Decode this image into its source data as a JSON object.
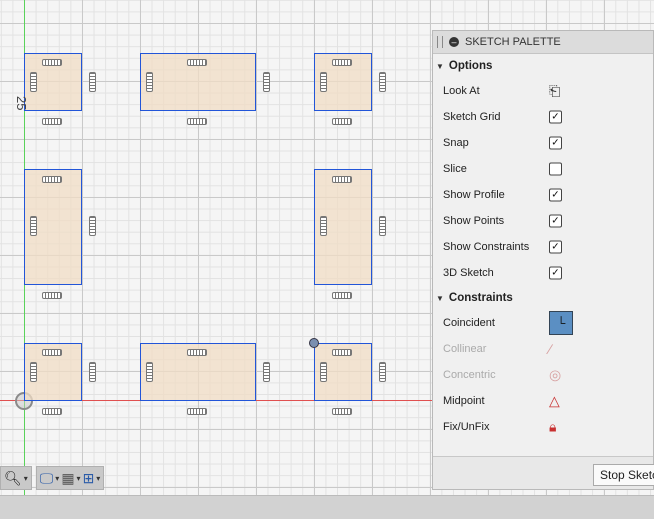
{
  "canvas": {
    "dimension_value": "25"
  },
  "palette": {
    "title": "SKETCH PALETTE",
    "options_header": "Options",
    "options": [
      {
        "label": "Look At",
        "control": "icon",
        "icon": "look-at-icon",
        "checked": null
      },
      {
        "label": "Sketch Grid",
        "control": "checkbox",
        "checked": true
      },
      {
        "label": "Snap",
        "control": "checkbox",
        "checked": true
      },
      {
        "label": "Slice",
        "control": "checkbox",
        "checked": false
      },
      {
        "label": "Show Profile",
        "control": "checkbox",
        "checked": true
      },
      {
        "label": "Show Points",
        "control": "checkbox",
        "checked": true
      },
      {
        "label": "Show Constraints",
        "control": "checkbox",
        "checked": true
      },
      {
        "label": "3D Sketch",
        "control": "checkbox",
        "checked": true
      }
    ],
    "constraints_header": "Constraints",
    "constraints": [
      {
        "label": "Coincident",
        "icon": "coincident-icon",
        "disabled": false
      },
      {
        "label": "Collinear",
        "icon": "collinear-icon",
        "disabled": true
      },
      {
        "label": "Concentric",
        "icon": "concentric-icon",
        "disabled": true
      },
      {
        "label": "Midpoint",
        "icon": "midpoint-icon",
        "disabled": false
      },
      {
        "label": "Fix/UnFix",
        "icon": "fix-unfix-icon",
        "disabled": false
      }
    ],
    "stop_button": "Stop Sketch"
  },
  "colors": {
    "sketch_line": "#2255d8",
    "profile_fill": "#f0dcc4",
    "axis_x": "#e05050",
    "axis_y": "#5ad25a"
  }
}
